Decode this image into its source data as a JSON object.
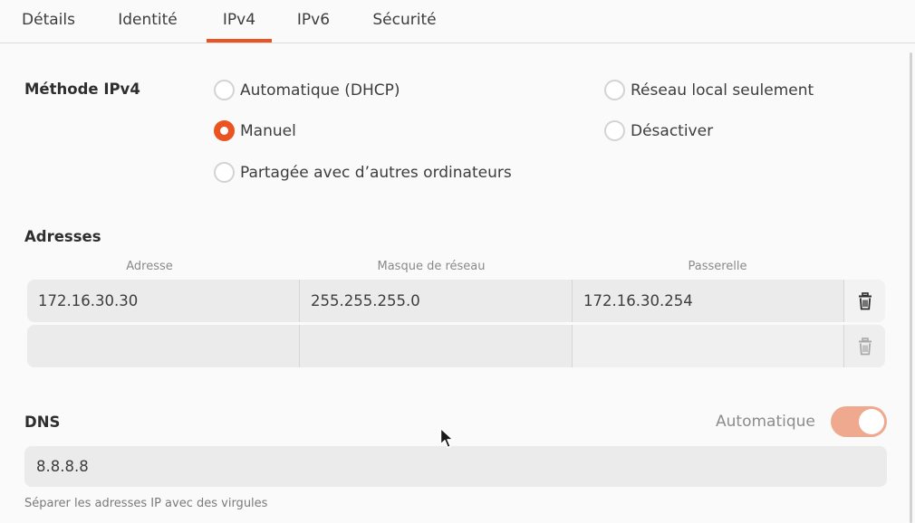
{
  "tabs": [
    {
      "label": "Détails"
    },
    {
      "label": "Identité"
    },
    {
      "label": "IPv4"
    },
    {
      "label": "IPv6"
    },
    {
      "label": "Sécurité"
    }
  ],
  "active_tab": "IPv4",
  "method": {
    "label": "Méthode IPv4",
    "options": [
      {
        "label": "Automatique (DHCP)",
        "checked": false
      },
      {
        "label": "Manuel",
        "checked": true
      },
      {
        "label": "Partagée avec d’autres ordinateurs",
        "checked": false
      },
      {
        "label": "Réseau local seulement",
        "checked": false
      },
      {
        "label": "Désactiver",
        "checked": false
      }
    ]
  },
  "addresses": {
    "label": "Adresses",
    "columns": [
      "Adresse",
      "Masque de réseau",
      "Passerelle"
    ],
    "rows": [
      {
        "address": "172.16.30.30",
        "netmask": "255.255.255.0",
        "gateway": "172.16.30.254"
      },
      {
        "address": "",
        "netmask": "",
        "gateway": ""
      }
    ]
  },
  "dns": {
    "label": "DNS",
    "auto_label": "Automatique",
    "auto_enabled": true,
    "value": "8.8.8.8",
    "hint": "Séparer les adresses IP avec des virgules"
  },
  "icons": {
    "delete": "trash-icon",
    "pointer": "mouse-cursor-icon"
  },
  "colors": {
    "accent": "#e95420",
    "toggle_on": "#efa98f",
    "field_bg": "#ebebeb"
  }
}
